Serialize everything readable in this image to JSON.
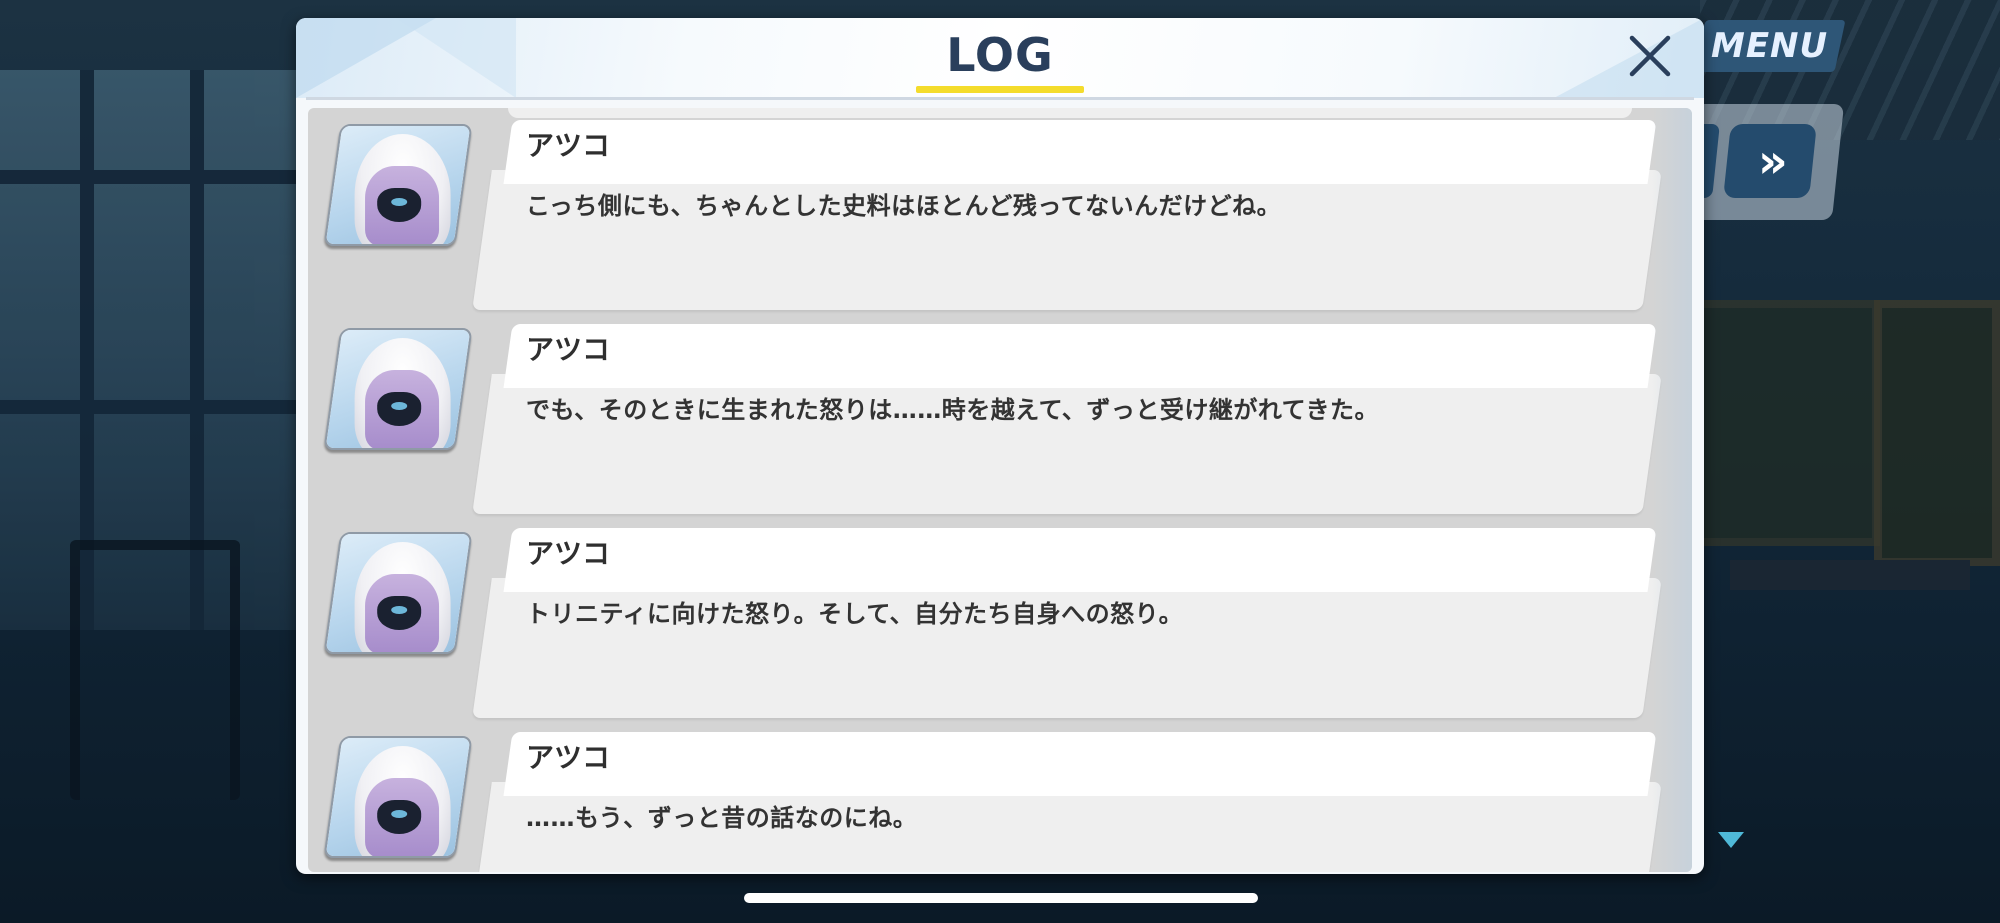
{
  "menu": {
    "label": "MENU"
  },
  "controls": {
    "fast_forward_label": "»"
  },
  "log_dialog": {
    "title": "LOG",
    "entries": [
      {
        "speaker": "アツコ",
        "text": "こっち側にも、ちゃんとした史料はほとんど残ってないんだけどね。"
      },
      {
        "speaker": "アツコ",
        "text": "でも、そのときに生まれた怒りは……時を越えて、ずっと受け継がれてきた。"
      },
      {
        "speaker": "アツコ",
        "text": "トリニティに向けた怒り。そして、自分たち自身への怒り。"
      },
      {
        "speaker": "アツコ",
        "text": "……もう、ずっと昔の話なのにね。"
      }
    ]
  },
  "colors": {
    "title_text": "#2a3f5c",
    "title_underline": "#f4dc2c",
    "menu_button": "#2e5677",
    "fast_forward_button": "#244b6d",
    "next_indicator": "#4fb9d8",
    "log_background": "#d4d4d4",
    "message_box": "#efefef"
  }
}
